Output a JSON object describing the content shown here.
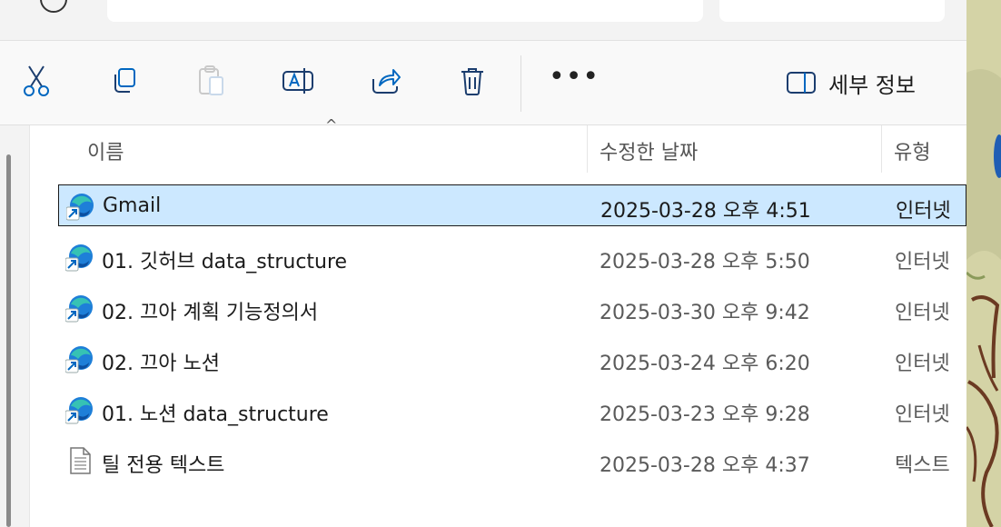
{
  "toolbar": {
    "cut_icon": "scissors-icon",
    "copy_icon": "copy-icon",
    "paste_icon": "paste-icon",
    "rename_icon": "rename-icon",
    "share_icon": "share-icon",
    "delete_icon": "trash-icon",
    "more_label": "•••",
    "details_label": "세부 정보",
    "details_icon": "details-pane-icon"
  },
  "columns": {
    "name": "이름",
    "date": "수정한 날짜",
    "type": "유형"
  },
  "files": [
    {
      "name": "Gmail",
      "date": "2025-03-28 오후 4:51",
      "type": "인터넷",
      "icon": "edge-shortcut-icon",
      "selected": true
    },
    {
      "name": "01. 깃허브 data_structure",
      "date": "2025-03-28 오후 5:50",
      "type": "인터넷",
      "icon": "edge-shortcut-icon"
    },
    {
      "name": "02. 끄아 계획 기능정의서",
      "date": "2025-03-30 오후 9:42",
      "type": "인터넷",
      "icon": "edge-shortcut-icon"
    },
    {
      "name": "02. 끄아 노션",
      "date": "2025-03-24 오후 6:20",
      "type": "인터넷",
      "icon": "edge-shortcut-icon"
    },
    {
      "name": "01. 노션 data_structure",
      "date": "2025-03-23 오후 9:28",
      "type": "인터넷",
      "icon": "edge-shortcut-icon"
    },
    {
      "name": "틸 전용 텍스트",
      "date": "2025-03-28 오후 4:37",
      "type": "텍스트",
      "icon": "text-file-icon"
    }
  ],
  "colors": {
    "selection": "#cce8ff",
    "accent": "#0067c0"
  }
}
